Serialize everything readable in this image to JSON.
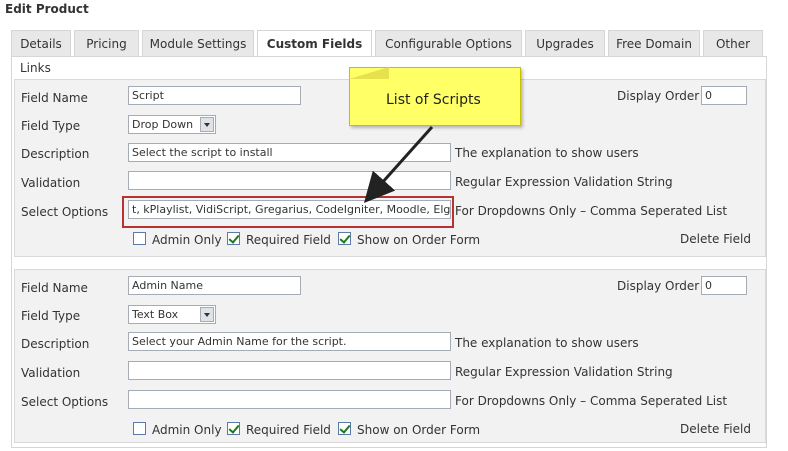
{
  "page_title": "Edit Product",
  "tabs": [
    "Details",
    "Pricing",
    "Module Settings",
    "Custom Fields",
    "Configurable Options",
    "Upgrades",
    "Free Domain",
    "Other"
  ],
  "active_tab": "Custom Fields",
  "links_label": "Links",
  "labels": {
    "field_name": "Field Name",
    "field_type": "Field Type",
    "description": "Description",
    "validation": "Validation",
    "select_options": "Select Options",
    "display_order": "Display Order",
    "description_hint": "The explanation to show users",
    "validation_hint": "Regular Expression Validation String",
    "select_options_hint": "For Dropdowns Only – Comma Seperated List",
    "admin_only": "Admin Only",
    "required_field": "Required Field",
    "show_on_order_form": "Show on Order Form",
    "delete_field": "Delete Field"
  },
  "fields": [
    {
      "field_name": "Script",
      "display_order": "0",
      "field_type": "Drop Down",
      "description": "Select the script to install",
      "validation": "",
      "select_options": "t, kPlaylist, VidiScript, Gregarius, CodeIgniter,  Moodle, Elgg",
      "admin_only": false,
      "required_field": true,
      "show_on_order_form": true
    },
    {
      "field_name": "Admin Name",
      "display_order": "0",
      "field_type": "Text Box",
      "description": "Select your Admin Name for the script.",
      "validation": "",
      "select_options": "",
      "admin_only": false,
      "required_field": true,
      "show_on_order_form": true
    }
  ],
  "callout": {
    "text": "List of Scripts",
    "color": "#ffff66",
    "highlight_color": "#b83232"
  }
}
